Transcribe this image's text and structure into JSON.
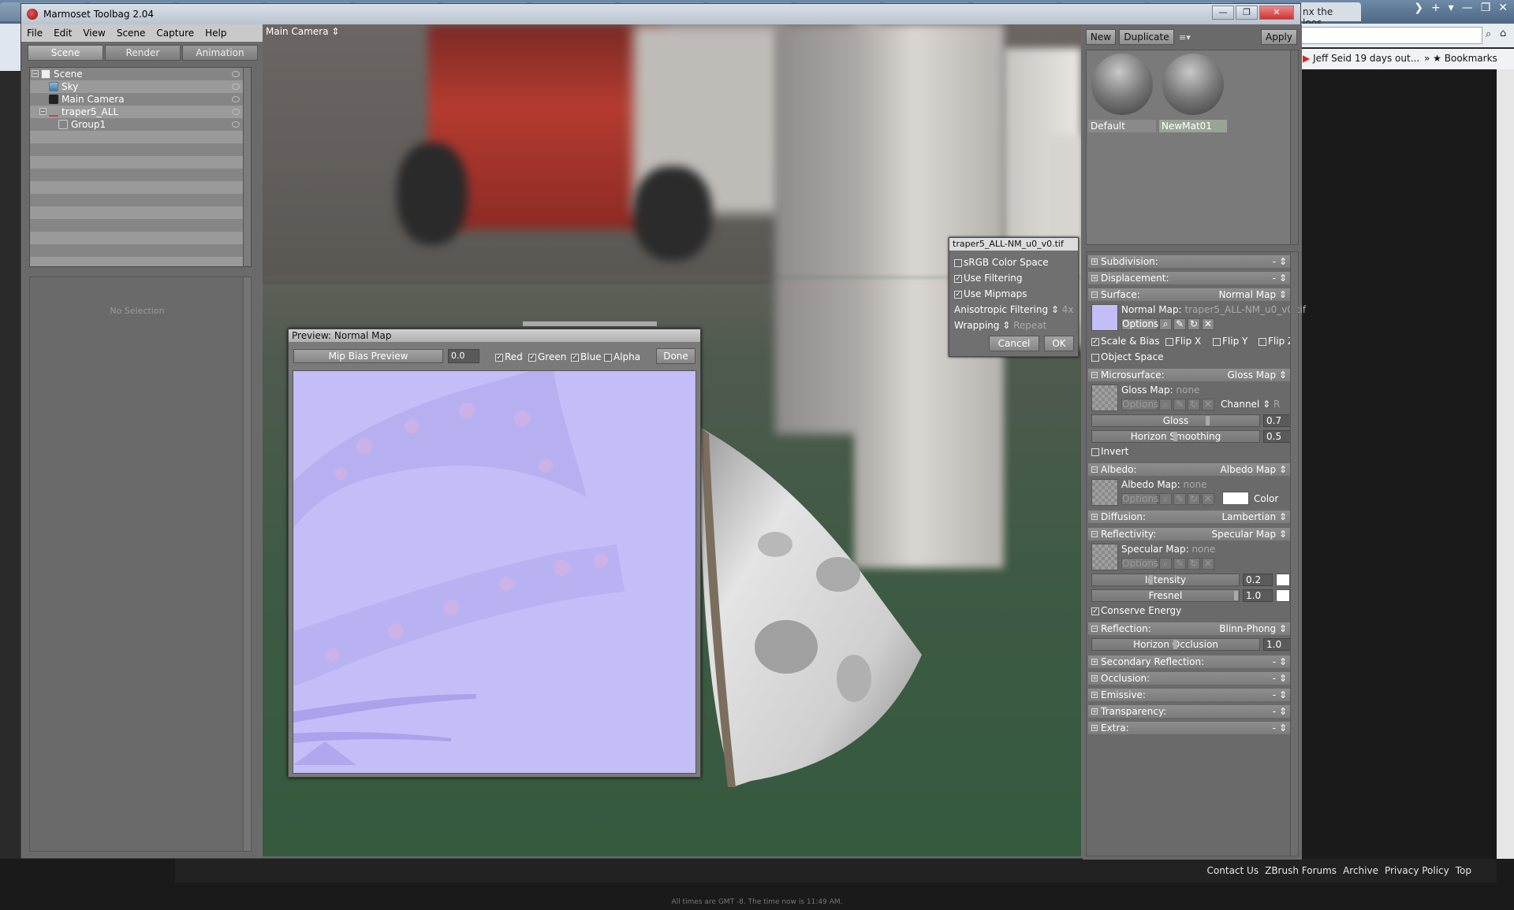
{
  "browser": {
    "tabs": [
      "",
      "",
      "",
      "",
      "",
      "",
      "",
      "",
      "",
      "",
      "",
      "",
      "",
      ""
    ],
    "right_tab": "nx the loos...",
    "bookmark_item": "Jeff Seid 19 days out...",
    "bookmarks_label": "Bookmarks"
  },
  "footer": {
    "links": [
      "Contact Us",
      "ZBrush Forums",
      "Archive",
      "Privacy Policy",
      "Top"
    ],
    "note": "All times are GMT -8. The time now is 11:49 AM."
  },
  "app": {
    "title": "Marmoset Toolbag 2.04",
    "menu": [
      "File",
      "Edit",
      "View",
      "Scene",
      "Capture",
      "Help"
    ],
    "window_buttons": {
      "minimize": "—",
      "restore": "❐",
      "close": "✕"
    }
  },
  "left_panel": {
    "tabs": [
      "Scene",
      "Render",
      "Animation"
    ],
    "tree": [
      {
        "label": "Scene"
      },
      {
        "label": "Sky"
      },
      {
        "label": "Main Camera"
      },
      {
        "label": "traper5_ALL"
      },
      {
        "label": "Group1"
      }
    ],
    "no_selection": "No Selection"
  },
  "viewport": {
    "camera": "Main Camera ⇕"
  },
  "preview": {
    "title": "Preview: Normal Map",
    "mip_label": "Mip Bias Preview",
    "mip_value": "0.0",
    "channels": [
      {
        "label": "Red",
        "checked": "✓"
      },
      {
        "label": "Green",
        "checked": "✓"
      },
      {
        "label": "Blue",
        "checked": "✓"
      },
      {
        "label": "Alpha",
        "checked": ""
      }
    ],
    "done": "Done"
  },
  "texture_popup": {
    "title": "traper5_ALL-NM_u0_v0.tif",
    "srgb": "sRGB Color Space",
    "filtering": "Use Filtering",
    "mipmaps": "Use Mipmaps",
    "check_on": "✓",
    "aniso_label": "Anisotropic Filtering ⇕",
    "aniso_value": "4x",
    "wrap_label": "Wrapping ⇕",
    "wrap_value": "Repeat",
    "cancel": "Cancel",
    "ok": "OK"
  },
  "right_panel": {
    "new": "New",
    "duplicate": "Duplicate",
    "menu_glyph": "≡▾",
    "apply": "Apply",
    "materials": [
      "Default",
      "NewMat01"
    ],
    "sections": {
      "subdivision": {
        "label": "Subdivision:",
        "value": "- ⇕"
      },
      "displacement": {
        "label": "Displacement:",
        "value": "- ⇕"
      },
      "surface": {
        "label": "Surface:",
        "value": "Normal Map ⇕"
      },
      "microsurface": {
        "label": "Microsurface:",
        "value": "Gloss Map ⇕"
      },
      "albedo": {
        "label": "Albedo:",
        "value": "Albedo Map ⇕"
      },
      "diffusion": {
        "label": "Diffusion:",
        "value": "Lambertian ⇕"
      },
      "reflectivity": {
        "label": "Reflectivity:",
        "value": "Specular Map ⇕"
      },
      "reflection": {
        "label": "Reflection:",
        "value": "Blinn-Phong ⇕"
      },
      "secondary": {
        "label": "Secondary Reflection:",
        "value": "- ⇕"
      },
      "occlusion": {
        "label": "Occlusion:",
        "value": "- ⇕"
      },
      "emissive": {
        "label": "Emissive:",
        "value": "- ⇕"
      },
      "transparency": {
        "label": "Transparency:",
        "value": "- ⇕"
      },
      "extra": {
        "label": "Extra:",
        "value": "- ⇕"
      }
    },
    "surface": {
      "map_label": "Normal Map:",
      "map_value": "traper5_ALL-NM_u0_v0.tif",
      "options": "Options",
      "scale_bias": "Scale & Bias",
      "flip_x": "Flip X",
      "flip_y": "Flip Y",
      "flip_z": "Flip Z",
      "object_space": "Object Space"
    },
    "micro": {
      "map_label": "Gloss Map:",
      "map_value": "none",
      "options": "Options",
      "channel_label": "Channel ⇕",
      "channel_value": "R",
      "gloss_label": "Gloss",
      "gloss_value": "0.7",
      "gloss_level": 0.7,
      "horizon_label": "Horizon Smoothing",
      "horizon_value": "0.5",
      "horizon_level": 0.5,
      "invert": "Invert"
    },
    "albedo": {
      "map_label": "Albedo Map:",
      "map_value": "none",
      "options": "Options",
      "color_label": "Color"
    },
    "reflect": {
      "map_label": "Specular Map:",
      "map_value": "none",
      "options": "Options",
      "intensity_label": "Intensity",
      "intensity_value": "0.2",
      "intensity_level": 0.4,
      "fresnel_label": "Fresnel",
      "fresnel_value": "1.0",
      "fresnel_level": 1.0,
      "conserve": "Conserve Energy"
    },
    "reflection": {
      "horizon_label": "Horizon Occlusion",
      "horizon_value": "1.0",
      "horizon_level": 0.5
    }
  },
  "colors": {
    "normal_map_base": "#c3bef8",
    "panel_bg": "#6a6a6a",
    "viewport_floor": "#355a3e"
  }
}
